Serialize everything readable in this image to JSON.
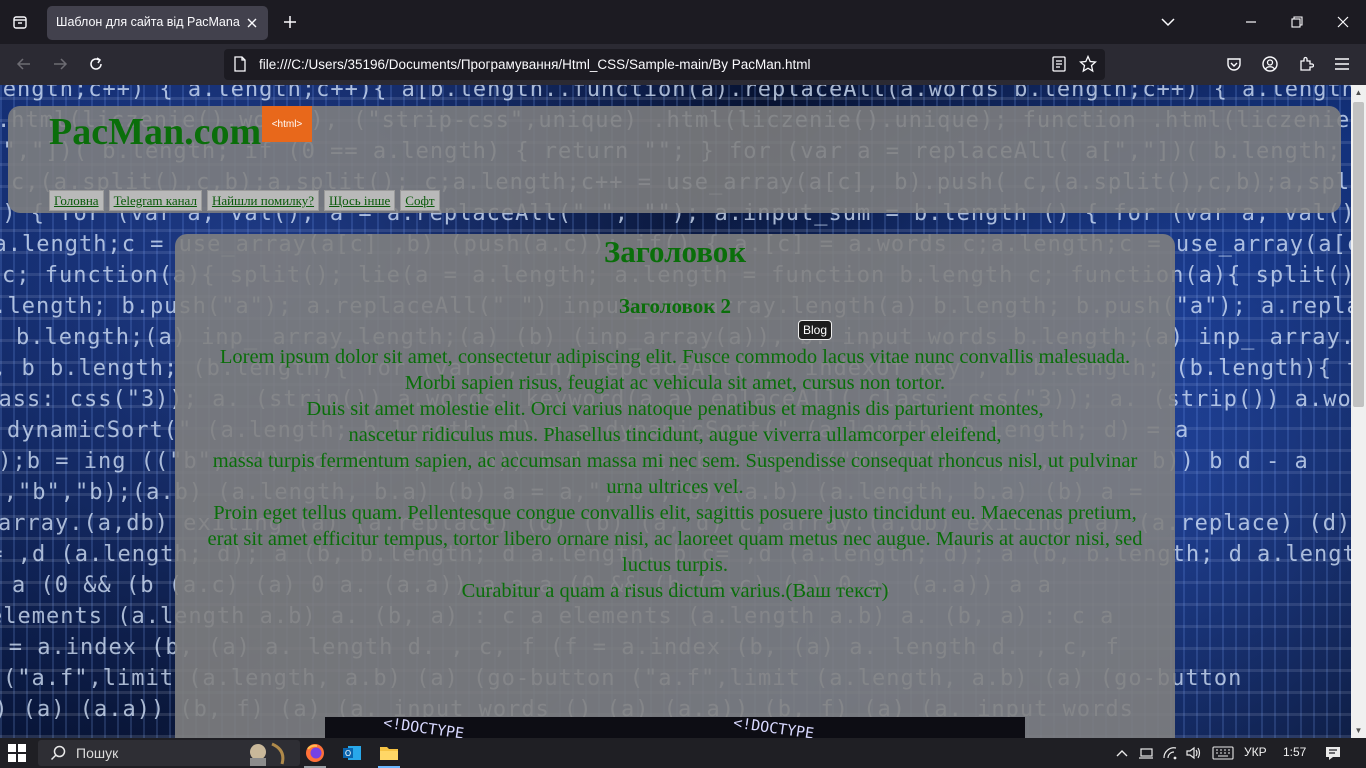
{
  "browser": {
    "tab_title": "Шаблон для сайта від PacMana",
    "url": "file:///C:/Users/35196/Documents/Програмування/Html_CSS/Sample-main/By PacMan.html",
    "icons": [
      "tab-list-icon",
      "close-icon",
      "plus-icon",
      "chevron-down-icon",
      "minimize-icon",
      "restore-icon",
      "window-close-icon",
      "back-icon",
      "forward-icon",
      "reload-icon",
      "page-icon",
      "reader-view-icon",
      "bookmark-star-icon",
      "pocket-icon",
      "account-icon",
      "extensions-icon",
      "menu-icon"
    ]
  },
  "site": {
    "logo": "PacMan.com",
    "badge": "<html>",
    "menu": [
      {
        "label": "Головна"
      },
      {
        "label": "Telegram канал"
      },
      {
        "label": "Найшли помилку?"
      },
      {
        "label": "Щось інше"
      },
      {
        "label": "Софт"
      }
    ],
    "heading1": "Заголовок",
    "heading2": "Заголовок 2",
    "tooltip": "Blog",
    "paragraph_lines": [
      "Lorem ipsum dolor sit amet, consectetur adipiscing elit. Fusce commodo lacus vitae nunc convallis malesuada.",
      "Morbi sapien risus, feugiat ac vehicula sit amet, cursus non tortor.",
      "Duis sit amet molestie elit. Orci varius natoque penatibus et magnis dis parturient montes,",
      "nascetur ridiculus mus. Phasellus tincidunt, augue viverra ullamcorper eleifend,",
      "massa turpis fermentum sapien, ac accumsan massa mi nec sem. Suspendisse consequat rhoncus nisl, ut pulvinar",
      "urna ultrices vel.",
      "Proin eget tellus quam. Pellentesque congue convallis elit, sagittis posuere justo tincidunt eu. Maecenas pretium,",
      "erat sit amet efficitur tempus, tortor libero ornare nisi, ac laoreet quam metus nec augue. Mauris at auctor nisi, sed luctus turpis.",
      "Curabitur a quam a risus dictum varius.(Ваш текст)"
    ],
    "code_strip": [
      "<!DOCTYPE",
      "<!DOCTYPE"
    ],
    "background_code": [
      "b.length;c++) { a.length;c++){ a[b.length..function(a).replaceAll(a.words",
      ".html(liczenie().words), (\"strip-css\",unique) .html(liczenie().unique); function",
      "a[\",\"])( b.length; if (0 == a.length) { return \"\"; } for (var a = replaceAll(",
      "c,(a.split(),c,b);a,split(); c;a.length;c++ = use_array(a[c], b).push(",
      "() { for (var a, val(); a = a.replaceAll(\" \", \"\"); a.input_sum = b.length",
      "c;a.length;c = use_array(a[c] ,b) (push(a.c)); if() { a.[c] = a.words",
      "c; function(a){ split(); lie(a = a.length; a.length = function b.length",
      "b.length; b.push(\"a\"); a.replaceAll(\" \") input_sum array.length(a)",
      "b.length;(a) inp_ array.length;(a) (b) (inp_array(a)), b. input words",
      ", b b.length; (b.length){ for (var b, in) replaceAll(\",\" indexOf_key",
      "class: css(\"3)); a. (strip()) a.words; keyword(a.a) eplaceAll(",
      "dynamicSort(\" (a.length; b.length; d) = a",
      "c);b = ing ((\"b\",\"b\") (c, d, a, c, b)) b d - a",
      "a,\",\"b\",\"b);(a.b) (a.length, b.a) (b) a =",
      "array.(a,db) exiting (a) (a.replace) (d) (b) (a, d) c;",
      "c= ,d (a.length; d); a (b, b.length; d a.length, b",
      "a (0 && (b (a.c) (a) 0 a. (a.a)) a a",
      "elements (a.length a.b) a. (b, a) : c a",
      "(f = a.index (b, (a) a. length d. , c, f",
      "(\"a.f\",limit (a.length, a.b) (a) (go-button",
      "() (a) (a.a)) (b, f) (a) (a. input words"
    ]
  },
  "taskbar": {
    "search_label": "Пошук",
    "language": "УКР",
    "time": "1:57",
    "icons": [
      "windows-start-icon",
      "search-icon",
      "firefox-icon",
      "outlook-icon",
      "file-explorer-icon",
      "tray-chevron-icon",
      "network-icon",
      "wifi-icon",
      "volume-icon",
      "keyboard-icon",
      "notification-icon"
    ]
  }
}
